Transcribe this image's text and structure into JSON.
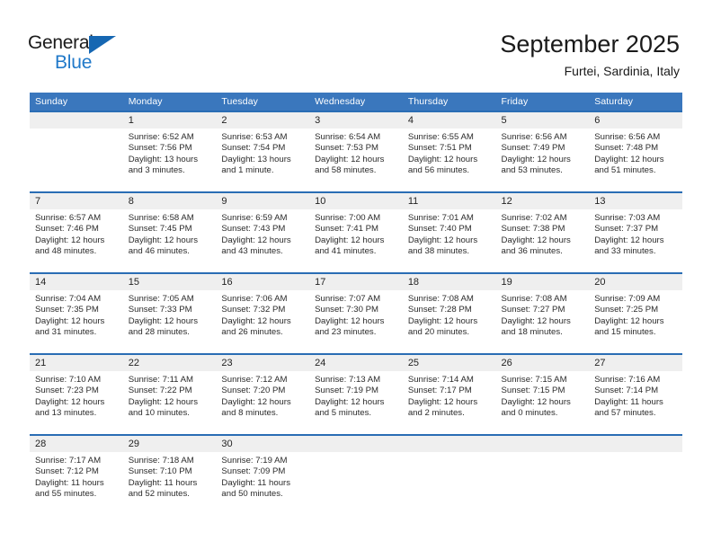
{
  "logo": {
    "word_top": "General",
    "word_bottom": "Blue",
    "triangle_color": "#1667b2",
    "blue_color": "#2079c9"
  },
  "header": {
    "title": "September 2025",
    "subtitle": "Furtei, Sardinia, Italy"
  },
  "theme": {
    "header_blue": "#3a77bd",
    "row_divider_blue": "#2a6db4",
    "date_band_gray": "#efefef"
  },
  "weekday_headers": [
    "Sunday",
    "Monday",
    "Tuesday",
    "Wednesday",
    "Thursday",
    "Friday",
    "Saturday"
  ],
  "labels": {
    "sunrise": "Sunrise:",
    "sunset": "Sunset:",
    "daylight": "Daylight:"
  },
  "weeks": [
    [
      {
        "day": "",
        "blank": true
      },
      {
        "day": "1",
        "sunrise": "Sunrise: 6:52 AM",
        "sunset": "Sunset: 7:56 PM",
        "daylight_1": "Daylight: 13 hours",
        "daylight_2": "and 3 minutes."
      },
      {
        "day": "2",
        "sunrise": "Sunrise: 6:53 AM",
        "sunset": "Sunset: 7:54 PM",
        "daylight_1": "Daylight: 13 hours",
        "daylight_2": "and 1 minute."
      },
      {
        "day": "3",
        "sunrise": "Sunrise: 6:54 AM",
        "sunset": "Sunset: 7:53 PM",
        "daylight_1": "Daylight: 12 hours",
        "daylight_2": "and 58 minutes."
      },
      {
        "day": "4",
        "sunrise": "Sunrise: 6:55 AM",
        "sunset": "Sunset: 7:51 PM",
        "daylight_1": "Daylight: 12 hours",
        "daylight_2": "and 56 minutes."
      },
      {
        "day": "5",
        "sunrise": "Sunrise: 6:56 AM",
        "sunset": "Sunset: 7:49 PM",
        "daylight_1": "Daylight: 12 hours",
        "daylight_2": "and 53 minutes."
      },
      {
        "day": "6",
        "sunrise": "Sunrise: 6:56 AM",
        "sunset": "Sunset: 7:48 PM",
        "daylight_1": "Daylight: 12 hours",
        "daylight_2": "and 51 minutes."
      }
    ],
    [
      {
        "day": "7",
        "sunrise": "Sunrise: 6:57 AM",
        "sunset": "Sunset: 7:46 PM",
        "daylight_1": "Daylight: 12 hours",
        "daylight_2": "and 48 minutes."
      },
      {
        "day": "8",
        "sunrise": "Sunrise: 6:58 AM",
        "sunset": "Sunset: 7:45 PM",
        "daylight_1": "Daylight: 12 hours",
        "daylight_2": "and 46 minutes."
      },
      {
        "day": "9",
        "sunrise": "Sunrise: 6:59 AM",
        "sunset": "Sunset: 7:43 PM",
        "daylight_1": "Daylight: 12 hours",
        "daylight_2": "and 43 minutes."
      },
      {
        "day": "10",
        "sunrise": "Sunrise: 7:00 AM",
        "sunset": "Sunset: 7:41 PM",
        "daylight_1": "Daylight: 12 hours",
        "daylight_2": "and 41 minutes."
      },
      {
        "day": "11",
        "sunrise": "Sunrise: 7:01 AM",
        "sunset": "Sunset: 7:40 PM",
        "daylight_1": "Daylight: 12 hours",
        "daylight_2": "and 38 minutes."
      },
      {
        "day": "12",
        "sunrise": "Sunrise: 7:02 AM",
        "sunset": "Sunset: 7:38 PM",
        "daylight_1": "Daylight: 12 hours",
        "daylight_2": "and 36 minutes."
      },
      {
        "day": "13",
        "sunrise": "Sunrise: 7:03 AM",
        "sunset": "Sunset: 7:37 PM",
        "daylight_1": "Daylight: 12 hours",
        "daylight_2": "and 33 minutes."
      }
    ],
    [
      {
        "day": "14",
        "sunrise": "Sunrise: 7:04 AM",
        "sunset": "Sunset: 7:35 PM",
        "daylight_1": "Daylight: 12 hours",
        "daylight_2": "and 31 minutes."
      },
      {
        "day": "15",
        "sunrise": "Sunrise: 7:05 AM",
        "sunset": "Sunset: 7:33 PM",
        "daylight_1": "Daylight: 12 hours",
        "daylight_2": "and 28 minutes."
      },
      {
        "day": "16",
        "sunrise": "Sunrise: 7:06 AM",
        "sunset": "Sunset: 7:32 PM",
        "daylight_1": "Daylight: 12 hours",
        "daylight_2": "and 26 minutes."
      },
      {
        "day": "17",
        "sunrise": "Sunrise: 7:07 AM",
        "sunset": "Sunset: 7:30 PM",
        "daylight_1": "Daylight: 12 hours",
        "daylight_2": "and 23 minutes."
      },
      {
        "day": "18",
        "sunrise": "Sunrise: 7:08 AM",
        "sunset": "Sunset: 7:28 PM",
        "daylight_1": "Daylight: 12 hours",
        "daylight_2": "and 20 minutes."
      },
      {
        "day": "19",
        "sunrise": "Sunrise: 7:08 AM",
        "sunset": "Sunset: 7:27 PM",
        "daylight_1": "Daylight: 12 hours",
        "daylight_2": "and 18 minutes."
      },
      {
        "day": "20",
        "sunrise": "Sunrise: 7:09 AM",
        "sunset": "Sunset: 7:25 PM",
        "daylight_1": "Daylight: 12 hours",
        "daylight_2": "and 15 minutes."
      }
    ],
    [
      {
        "day": "21",
        "sunrise": "Sunrise: 7:10 AM",
        "sunset": "Sunset: 7:23 PM",
        "daylight_1": "Daylight: 12 hours",
        "daylight_2": "and 13 minutes."
      },
      {
        "day": "22",
        "sunrise": "Sunrise: 7:11 AM",
        "sunset": "Sunset: 7:22 PM",
        "daylight_1": "Daylight: 12 hours",
        "daylight_2": "and 10 minutes."
      },
      {
        "day": "23",
        "sunrise": "Sunrise: 7:12 AM",
        "sunset": "Sunset: 7:20 PM",
        "daylight_1": "Daylight: 12 hours",
        "daylight_2": "and 8 minutes."
      },
      {
        "day": "24",
        "sunrise": "Sunrise: 7:13 AM",
        "sunset": "Sunset: 7:19 PM",
        "daylight_1": "Daylight: 12 hours",
        "daylight_2": "and 5 minutes."
      },
      {
        "day": "25",
        "sunrise": "Sunrise: 7:14 AM",
        "sunset": "Sunset: 7:17 PM",
        "daylight_1": "Daylight: 12 hours",
        "daylight_2": "and 2 minutes."
      },
      {
        "day": "26",
        "sunrise": "Sunrise: 7:15 AM",
        "sunset": "Sunset: 7:15 PM",
        "daylight_1": "Daylight: 12 hours",
        "daylight_2": "and 0 minutes."
      },
      {
        "day": "27",
        "sunrise": "Sunrise: 7:16 AM",
        "sunset": "Sunset: 7:14 PM",
        "daylight_1": "Daylight: 11 hours",
        "daylight_2": "and 57 minutes."
      }
    ],
    [
      {
        "day": "28",
        "sunrise": "Sunrise: 7:17 AM",
        "sunset": "Sunset: 7:12 PM",
        "daylight_1": "Daylight: 11 hours",
        "daylight_2": "and 55 minutes."
      },
      {
        "day": "29",
        "sunrise": "Sunrise: 7:18 AM",
        "sunset": "Sunset: 7:10 PM",
        "daylight_1": "Daylight: 11 hours",
        "daylight_2": "and 52 minutes."
      },
      {
        "day": "30",
        "sunrise": "Sunrise: 7:19 AM",
        "sunset": "Sunset: 7:09 PM",
        "daylight_1": "Daylight: 11 hours",
        "daylight_2": "and 50 minutes."
      },
      {
        "day": "",
        "blank": true
      },
      {
        "day": "",
        "blank": true
      },
      {
        "day": "",
        "blank": true
      },
      {
        "day": "",
        "blank": true
      }
    ]
  ]
}
